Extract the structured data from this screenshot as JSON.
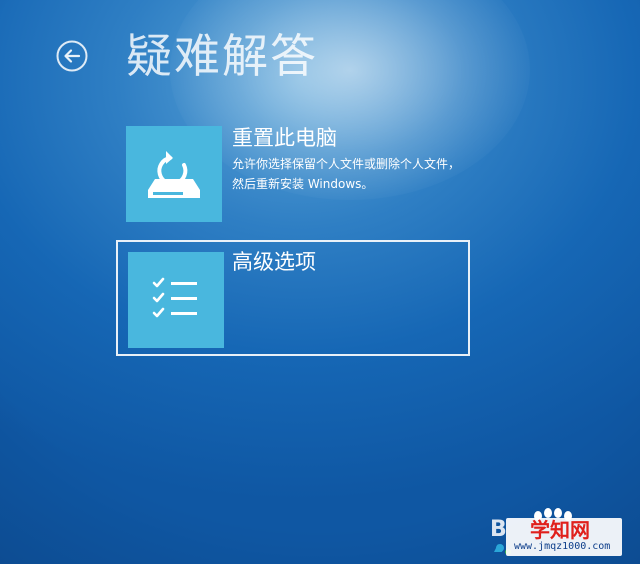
{
  "page": {
    "title": "疑难解答",
    "back_icon": "back-arrow-icon"
  },
  "options": [
    {
      "title": "重置此电脑",
      "description": "允许你选择保留个人文件或删除个人文件，然后重新安装 Windows。",
      "icon": "reset-pc-icon",
      "selected": false
    },
    {
      "title": "高级选项",
      "description": "",
      "icon": "checklist-icon",
      "selected": true
    }
  ],
  "watermark": {
    "title": "学知网",
    "url": "www.jmqz1000.com"
  },
  "colors": {
    "background": "#1667b5",
    "tile": "#49b7de",
    "text": "#ffffff",
    "watermark_title": "#e0201c",
    "watermark_url": "#0c3d8a"
  }
}
